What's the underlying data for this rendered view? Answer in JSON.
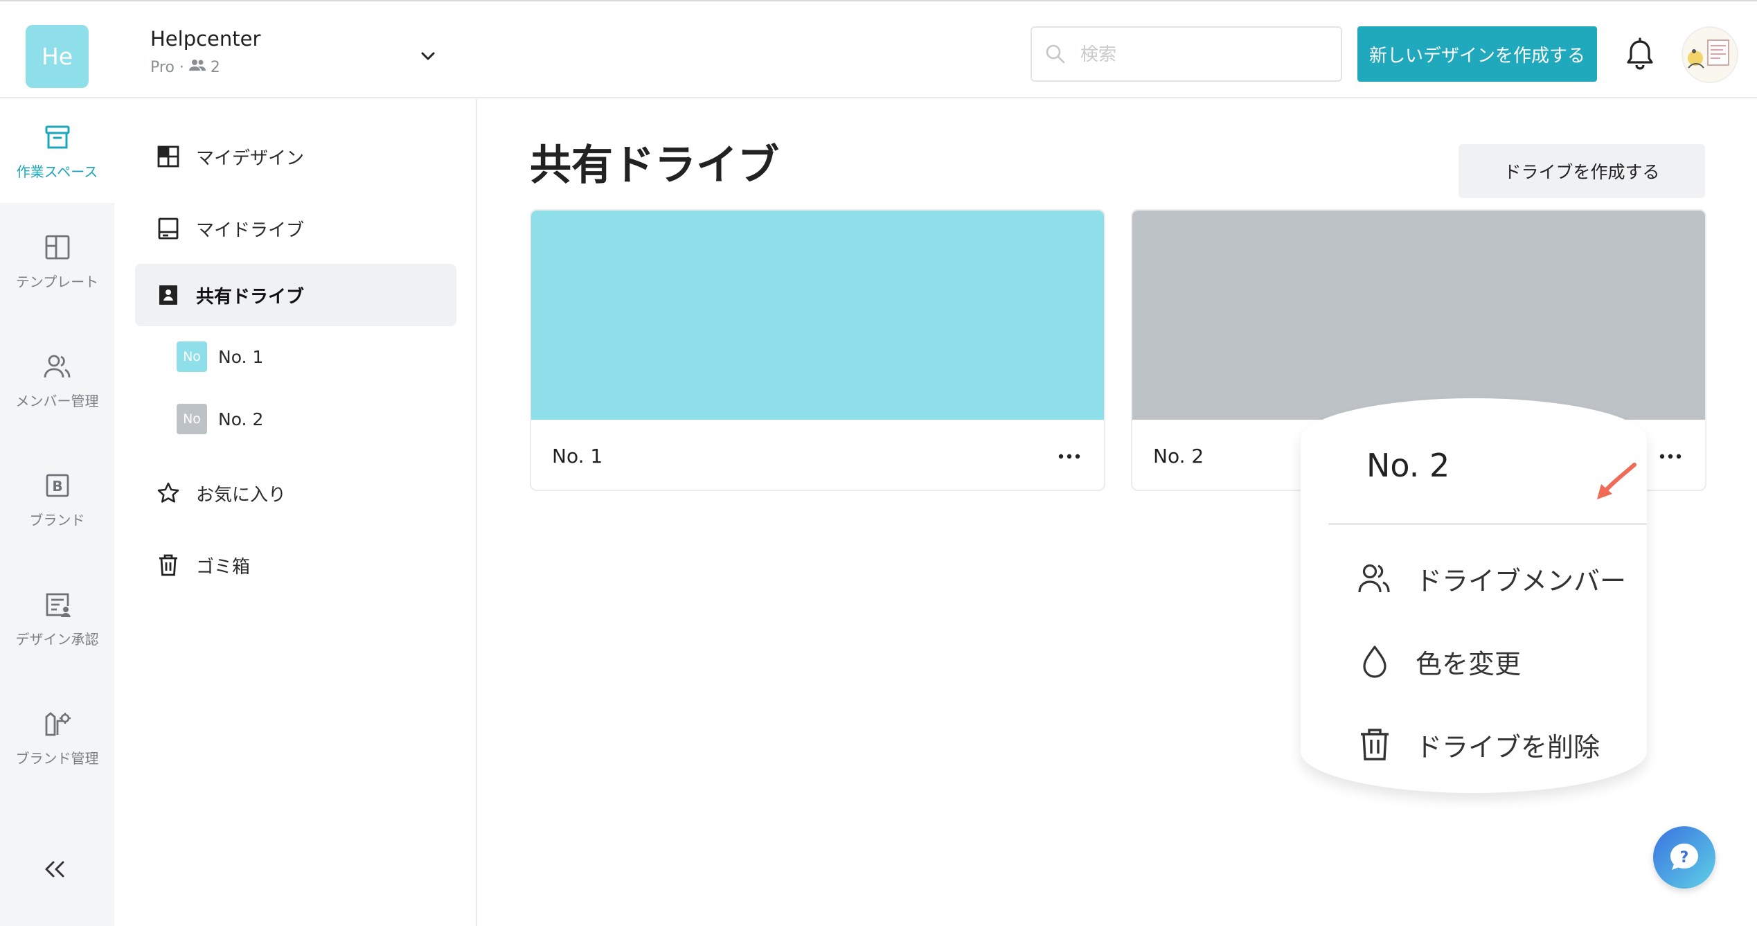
{
  "header": {
    "team_logo": "He",
    "team_name": "Helpcenter",
    "team_plan": "Pro ·",
    "team_members": "2",
    "search_placeholder": "検索",
    "create_label": "新しいデザインを作成する"
  },
  "rail": {
    "items": [
      {
        "label": "作業スペース",
        "icon": "archive-box-icon"
      },
      {
        "label": "テンプレート",
        "icon": "layout-icon"
      },
      {
        "label": "メンバー管理",
        "icon": "users-icon"
      },
      {
        "label": "ブランド",
        "icon": "brand-icon"
      },
      {
        "label": "デザイン承認",
        "icon": "approval-icon"
      },
      {
        "label": "ブランド管理",
        "icon": "brand-settings-icon"
      }
    ],
    "collapse": "«"
  },
  "sidebar": {
    "my_designs": "マイデザイン",
    "my_drive": "マイドライブ",
    "shared_drive": "共有ドライブ",
    "sub_items": [
      {
        "badge": "No",
        "label": "No. 1",
        "color": "#8fdfea"
      },
      {
        "badge": "No",
        "label": "No. 2",
        "color": "#bdc2c7"
      }
    ],
    "favorites": "お気に入り",
    "trash": "ゴミ箱"
  },
  "main": {
    "title": "共有ドライブ",
    "create_drive": "ドライブを作成する",
    "cards": [
      {
        "name": "No. 1",
        "color": "#8fdfea"
      },
      {
        "name": "No. 2",
        "color": "#bdc2c7"
      }
    ]
  },
  "context_menu": {
    "title": "No. 2",
    "items": [
      {
        "label": "ドライブメンバー",
        "icon": "users-icon"
      },
      {
        "label": "色を変更",
        "icon": "droplet-icon"
      },
      {
        "label": "ドライブを削除",
        "icon": "trash-icon"
      }
    ]
  },
  "colors": {
    "accent": "#20a8bc",
    "arrow": "#ef6b56"
  }
}
